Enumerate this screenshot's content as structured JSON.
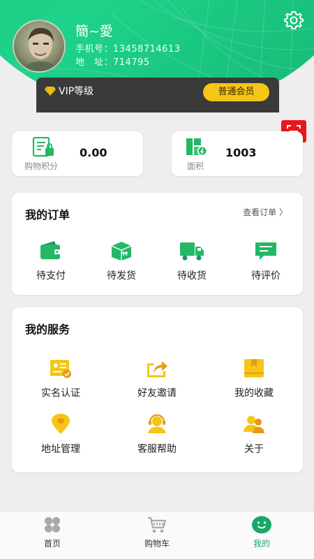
{
  "profile": {
    "name": "簡~愛",
    "phone_line": "手机号：13458714613",
    "address_line": "地　址：714795"
  },
  "vip": {
    "label": "VIP等级",
    "level_button": "普通会员"
  },
  "stats": [
    {
      "label": "购物积分",
      "value": "0.00",
      "icon": "points-card-icon"
    },
    {
      "label": "面积",
      "value": "1003",
      "icon": "area-map-icon"
    }
  ],
  "orders": {
    "title": "我的订单",
    "view_all": "查看订单 〉",
    "items": [
      {
        "label": "待支付",
        "icon": "wallet-icon"
      },
      {
        "label": "待发货",
        "icon": "package-icon"
      },
      {
        "label": "待收货",
        "icon": "truck-icon"
      },
      {
        "label": "待评价",
        "icon": "comment-icon"
      }
    ]
  },
  "services": {
    "title": "我的服务",
    "items": [
      {
        "label": "实名认证",
        "icon": "id-card-icon"
      },
      {
        "label": "好友邀请",
        "icon": "share-icon"
      },
      {
        "label": "我的收藏",
        "icon": "bookmark-icon"
      },
      {
        "label": "地址管理",
        "icon": "location-icon"
      },
      {
        "label": "客服帮助",
        "icon": "headset-icon"
      },
      {
        "label": "关于",
        "icon": "users-icon"
      }
    ]
  },
  "nav": {
    "items": [
      {
        "label": "首页",
        "icon": "home-grid-icon"
      },
      {
        "label": "购物车",
        "icon": "cart-icon"
      },
      {
        "label": "我的",
        "icon": "smiley-icon"
      }
    ],
    "active_color": "#1aa867"
  },
  "colors": {
    "brand_green": "#1fc47f",
    "vip_gold": "#f5c518",
    "scan_red": "#e8161f",
    "icon_green": "#22b866",
    "service_gold": "#f2b320"
  }
}
